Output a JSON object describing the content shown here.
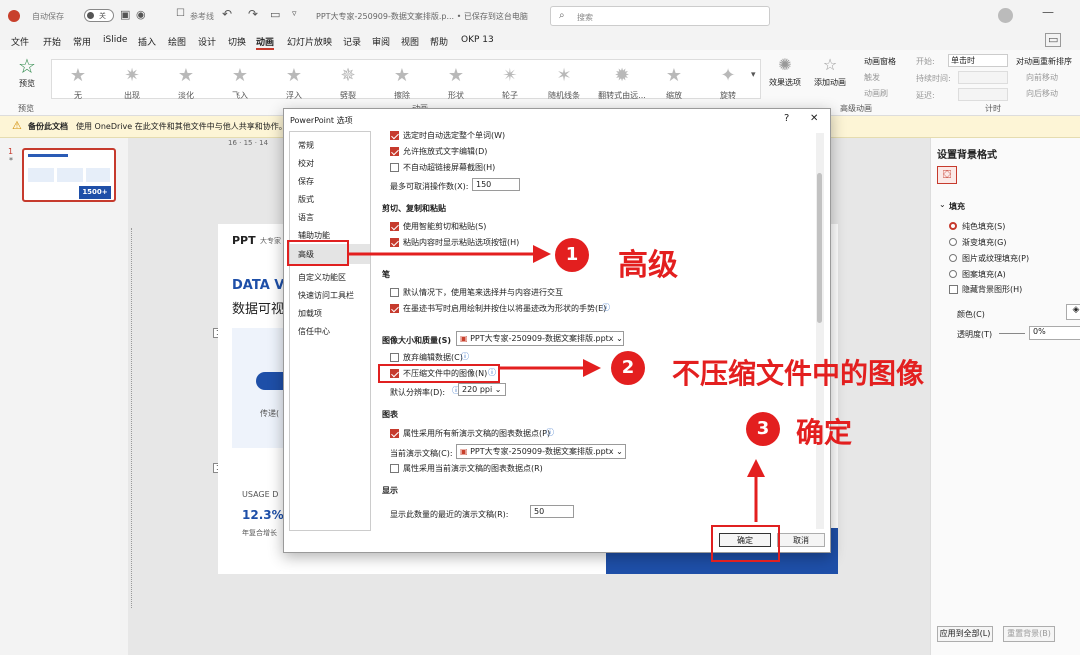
{
  "titlebar": {
    "autosave_label": "自动保存",
    "autosave_state": "关",
    "reference_label": "参考线",
    "doc_title": "PPT大专家-250909-数据文案排版.p... • 已保存到这台电脑",
    "search_placeholder": "搜索"
  },
  "menu": [
    "文件",
    "开始",
    "常用",
    "iSlide",
    "插入",
    "绘图",
    "设计",
    "切换",
    "动画",
    "幻灯片放映",
    "记录",
    "审阅",
    "视图",
    "帮助",
    "OKP 13"
  ],
  "ribbon": {
    "preview_label": "预览",
    "preview_group": "预览",
    "animations": [
      "无",
      "出现",
      "淡化",
      "飞入",
      "浮入",
      "劈裂",
      "擦除",
      "形状",
      "轮子",
      "随机线条",
      "翻转式由远...",
      "缩放",
      "旋转"
    ],
    "anim_group": "动画",
    "effect_options": "效果选项",
    "add_animation": "添加动画",
    "anim_pane": "动画窗格",
    "trigger": "触发",
    "anim_painter": "动画刷",
    "advanced_group": "高级动画",
    "start_label": "开始:",
    "start_value": "单击时",
    "duration_label": "持续时间:",
    "delay_label": "延迟:",
    "timing_group": "计时",
    "reorder": "对动画重新排序",
    "move_earlier": "向前移动",
    "move_later": "向后移动"
  },
  "infobar": {
    "title": "备份此文档",
    "message": "使用 OneDrive 在此文件和其他文件中与他人共享和协作。"
  },
  "thumb": {
    "number": "1",
    "star": "*",
    "badge": "1500+"
  },
  "ruler": "16 · 15 · 14",
  "slide": {
    "brand": "PPT",
    "brand_sub": "大专家",
    "heading": "DATA VI",
    "subheading": "数据可视化",
    "caption": "传递(",
    "usage": "USAGE D",
    "percent": "12.3%",
    "growth": "年复合增长",
    "marker": "1"
  },
  "dialog": {
    "title": "PowerPoint 选项",
    "help": "?",
    "close": "✕",
    "nav": [
      "常规",
      "校对",
      "保存",
      "版式",
      "语言",
      "辅助功能",
      "高级",
      "自定义功能区",
      "快速访问工具栏",
      "加载项",
      "信任中心"
    ],
    "opt_autoword": "选定时自动选定整个单词(W)",
    "opt_dragdrop": "允许拖放式文字编辑(D)",
    "opt_hyperlink_screenshot": "不自动超链接屏幕截图(H)",
    "undo_label": "最多可取消操作数(X):",
    "undo_value": "150",
    "sec_cut": "剪切、复制和粘贴",
    "opt_smartcut": "使用智能剪切和粘贴(S)",
    "opt_pastebtn": "粘贴内容时显示粘贴选项按钮(H)",
    "sec_pen": "笔",
    "opt_pen_default": "默认情况下，使用笔来选择并与内容进行交互",
    "opt_pen_switch": "在墨迹书写时启用绘制并按住以将墨迹改为形状的手势(E)",
    "sec_image": "图像大小和质量(S)",
    "image_file": "PPT大专家-250909-数据文案排版.pptx",
    "opt_discard": "放弃编辑数据(C)",
    "opt_nocompress": "不压缩文件中的图像(N)",
    "resolution_label": "默认分辨率(D):",
    "resolution_value": "220 ppi",
    "sec_chart": "图表",
    "opt_chart_all": "属性采用所有新演示文稿的图表数据点(P)",
    "current_doc_label": "当前演示文稿(C):",
    "current_doc_value": "PPT大专家-250909-数据文案排版.pptx",
    "opt_chart_current": "属性采用当前演示文稿的图表数据点(R)",
    "sec_display": "显示",
    "recent_label": "显示此数量的最近的演示文稿(R):",
    "recent_value": "50",
    "ok": "确定",
    "cancel": "取消"
  },
  "annotations": {
    "step1_num": "1",
    "step1_text": "高级",
    "step2_num": "2",
    "step2_text": "不压缩文件中的图像",
    "step3_num": "3",
    "step3_text": "确定"
  },
  "rightpane": {
    "title": "设置背景格式",
    "fill_header": "填充",
    "solid": "纯色填充(S)",
    "gradient": "渐变填充(G)",
    "picture": "图片或纹理填充(P)",
    "pattern": "图案填充(A)",
    "hide_bg": "隐藏背景图形(H)",
    "color_label": "颜色(C)",
    "transparency_label": "透明度(T)",
    "transparency_value": "0%",
    "apply_all": "应用到全部(L)",
    "reset_bg": "重置背景(B)"
  },
  "colors": {
    "accent": "#c63a2d",
    "annotation": "#e31f1f"
  }
}
